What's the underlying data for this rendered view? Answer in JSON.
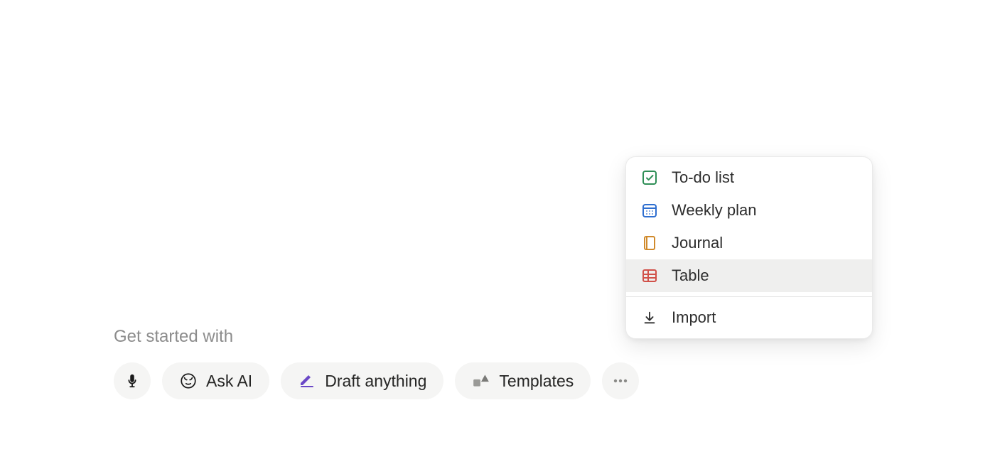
{
  "heading": "Get started with",
  "pills": {
    "ask_ai": "Ask AI",
    "draft": "Draft anything",
    "templates": "Templates"
  },
  "menu": {
    "todo": "To-do list",
    "weekly": "Weekly plan",
    "journal": "Journal",
    "table": "Table",
    "import": "Import"
  }
}
